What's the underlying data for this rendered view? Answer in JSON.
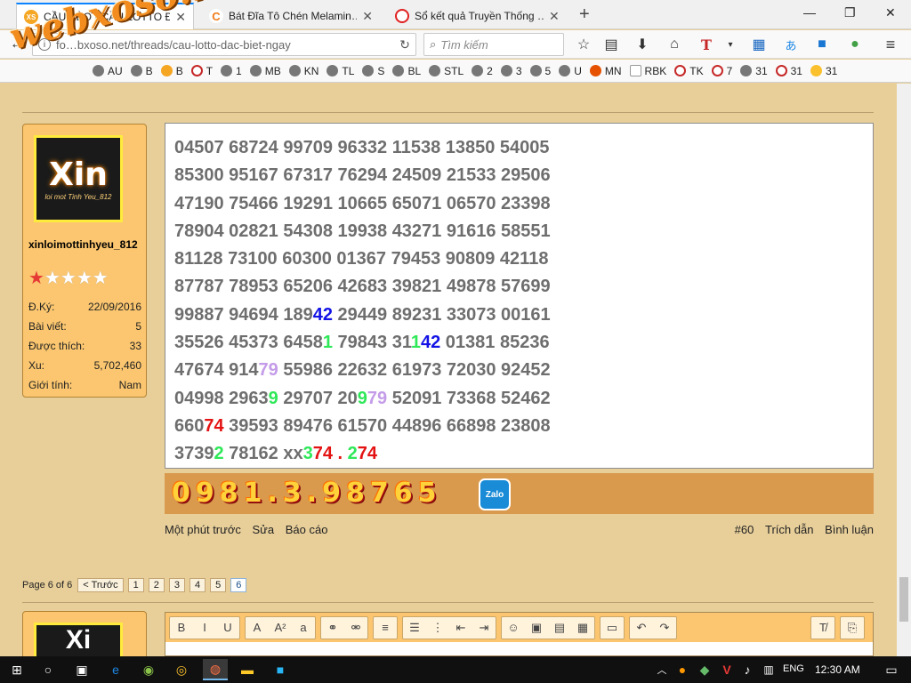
{
  "browser": {
    "tabs": [
      {
        "title": "CẦU KÈO - CẦU LOTTO Đ",
        "icon": "xs-icon",
        "color": "#f5a623",
        "icon_text": "XS"
      },
      {
        "title": "Bát Đĩa Tô Chén Melamin…",
        "icon": "c-logo-icon",
        "color": "#f07b1a",
        "icon_text": "C"
      },
      {
        "title": "Sổ kết quả Truyền Thống …",
        "icon": "no-sign-icon",
        "color": "#e02020",
        "icon_text": ""
      }
    ],
    "new_tab": "+",
    "window": {
      "minimize": "—",
      "restore": "❐",
      "close": "✕"
    },
    "url": "fo…bxoso.net/threads/cau-lotto-dac-biet-ngay",
    "search_placeholder": "Tìm kiếm",
    "watermark": "webxoso.net"
  },
  "bookmarks": [
    "AU",
    "B",
    "B",
    "T",
    "1",
    "MB",
    "KN",
    "TL",
    "S",
    "BL",
    "STL",
    "2",
    "3",
    "5",
    "U",
    "MN",
    "RBK",
    "TK",
    "7",
    "31",
    "31",
    "31"
  ],
  "user": {
    "name": "xinloimottinhyeu_812",
    "avatar_big": "Xin",
    "avatar_small": "loi mot Tinh Yeu_812",
    "stars_filled": 1,
    "stars_total": 5,
    "stats": [
      {
        "label": "Đ.Ký:",
        "value": "22/09/2016"
      },
      {
        "label": "Bài viết:",
        "value": "5"
      },
      {
        "label": "Được thích:",
        "value": "33"
      },
      {
        "label": "Xu:",
        "value": "5,702,460"
      },
      {
        "label": "Giới tính:",
        "value": "Nam"
      }
    ]
  },
  "post": {
    "lines": [
      [
        {
          "t": "04507 68724 99709 96332 11538 13850 54005",
          "c": ""
        }
      ],
      [
        {
          "t": "85300 95167 67317 76294 24509 21533 29506",
          "c": ""
        }
      ],
      [
        {
          "t": "47190 75466 19291 10665 65071 06570 23398",
          "c": ""
        }
      ],
      [
        {
          "t": "78904 02821 54308 19938 43271 91616 58551",
          "c": ""
        }
      ],
      [
        {
          "t": "81128 73100 60300 01367 79453 90809 42118",
          "c": ""
        }
      ],
      [
        {
          "t": "87787 78953 65206 42683 39821 49878 57699",
          "c": ""
        }
      ],
      [
        {
          "t": "99887 94694 189",
          "c": ""
        },
        {
          "t": "42",
          "c": "blue"
        },
        {
          "t": " 29449 89231 33073 00161",
          "c": ""
        }
      ],
      [
        {
          "t": "35526 45373 6458",
          "c": ""
        },
        {
          "t": "1",
          "c": "green"
        },
        {
          "t": " 79843 31",
          "c": ""
        },
        {
          "t": "1",
          "c": "green"
        },
        {
          "t": "42",
          "c": "blue"
        },
        {
          "t": " 01381 85236",
          "c": ""
        }
      ],
      [
        {
          "t": "47674 914",
          "c": ""
        },
        {
          "t": "79",
          "c": "purple"
        },
        {
          "t": " 55986 22632 61973 72030 92452",
          "c": ""
        }
      ],
      [
        {
          "t": "04998 2963",
          "c": ""
        },
        {
          "t": "9",
          "c": "green"
        },
        {
          "t": " 29707 20",
          "c": ""
        },
        {
          "t": "9",
          "c": "green"
        },
        {
          "t": "79",
          "c": "purple"
        },
        {
          "t": " 52091 73368 52462",
          "c": ""
        }
      ],
      [
        {
          "t": "660",
          "c": ""
        },
        {
          "t": "74",
          "c": "red"
        },
        {
          "t": " 39593 89476 61570 44896 66898 23808",
          "c": ""
        }
      ],
      [
        {
          "t": "3739",
          "c": ""
        },
        {
          "t": "2",
          "c": "green"
        },
        {
          "t": " 78162 xx",
          "c": ""
        },
        {
          "t": "3",
          "c": "green"
        },
        {
          "t": "74 . ",
          "c": "red"
        },
        {
          "t": "2",
          "c": "green"
        },
        {
          "t": "74",
          "c": "red"
        }
      ]
    ],
    "phone": "0981.3.98765",
    "zalo_label": "Zalo",
    "footer_left": [
      "Một phút trước",
      "Sửa",
      "Báo cáo"
    ],
    "footer_right": [
      "#60",
      "Trích dẫn",
      "Bình luận"
    ]
  },
  "pagination": {
    "label": "Page 6 of 6",
    "prev": "< Trước",
    "pages": [
      "1",
      "2",
      "3",
      "4",
      "5",
      "6"
    ],
    "current": "6"
  },
  "user2": {
    "avatar_big": "Xi"
  },
  "editor": {
    "groups": [
      [
        {
          "icon": "bold-icon",
          "g": "B"
        },
        {
          "icon": "italic-icon",
          "g": "I"
        },
        {
          "icon": "underline-icon",
          "g": "U"
        }
      ],
      [
        {
          "icon": "font-color-icon",
          "g": "A"
        },
        {
          "icon": "font-size-icon",
          "g": "A²"
        },
        {
          "icon": "font-family-icon",
          "g": "a"
        }
      ],
      [
        {
          "icon": "link-icon",
          "g": "⚭"
        },
        {
          "icon": "unlink-icon",
          "g": "⚮"
        }
      ],
      [
        {
          "icon": "align-icon",
          "g": "≡"
        }
      ],
      [
        {
          "icon": "bullet-list-icon",
          "g": "☰"
        },
        {
          "icon": "number-list-icon",
          "g": "⋮"
        },
        {
          "icon": "outdent-icon",
          "g": "⇤"
        },
        {
          "icon": "indent-icon",
          "g": "⇥"
        }
      ],
      [
        {
          "icon": "smiley-icon",
          "g": "☺"
        },
        {
          "icon": "image-icon",
          "g": "▣"
        },
        {
          "icon": "media-icon",
          "g": "▤"
        },
        {
          "icon": "more-insert-icon",
          "g": "▦"
        }
      ],
      [
        {
          "icon": "save-draft-icon",
          "g": "▭"
        }
      ],
      [
        {
          "icon": "undo-icon",
          "g": "↶"
        },
        {
          "icon": "redo-icon",
          "g": "↷"
        }
      ]
    ],
    "right_groups": [
      [
        {
          "icon": "remove-format-icon",
          "g": "T̸"
        }
      ],
      [
        {
          "icon": "toggle-bbcode-icon",
          "g": "⎘"
        }
      ]
    ]
  },
  "taskbar": {
    "lang": "ENG",
    "time": "12:30 AM"
  }
}
